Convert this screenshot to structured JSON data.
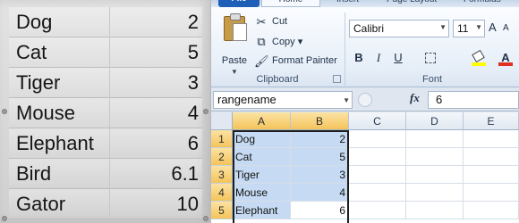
{
  "left_list": {
    "rows": [
      {
        "name": "Dog",
        "value": "2"
      },
      {
        "name": "Cat",
        "value": "5"
      },
      {
        "name": "Tiger",
        "value": "3"
      },
      {
        "name": "Mouse",
        "value": "4"
      },
      {
        "name": "Elephant",
        "value": "6"
      },
      {
        "name": "Bird",
        "value": "6.1"
      },
      {
        "name": "Gator",
        "value": "10"
      }
    ]
  },
  "ribbon": {
    "tabs": {
      "file": "File",
      "home": "Home",
      "insert": "Insert",
      "page_layout": "Page Layout",
      "formulas": "Formulas"
    },
    "clipboard": {
      "paste": "Paste",
      "cut": "Cut",
      "copy": "Copy",
      "format_painter": "Format Painter",
      "group_label": "Clipboard"
    },
    "font": {
      "font_name": "Calibri",
      "font_size": "11",
      "bold": "B",
      "italic": "I",
      "underline": "U",
      "font_color_letter": "A",
      "group_label": "Font",
      "fill_color": "#ffff00",
      "text_color": "#e0301e"
    }
  },
  "formula_bar": {
    "name_box": "rangename",
    "fx": "fx",
    "formula": "6"
  },
  "grid": {
    "columns": [
      "A",
      "B",
      "C",
      "D",
      "E"
    ],
    "rows": [
      {
        "num": "1",
        "a": "Dog",
        "b": "2"
      },
      {
        "num": "2",
        "a": "Cat",
        "b": "5"
      },
      {
        "num": "3",
        "a": "Tiger",
        "b": "3"
      },
      {
        "num": "4",
        "a": "Mouse",
        "b": "4"
      },
      {
        "num": "5",
        "a": "Elephant",
        "b": "6"
      }
    ],
    "selection_color": "#c6dbf3"
  }
}
